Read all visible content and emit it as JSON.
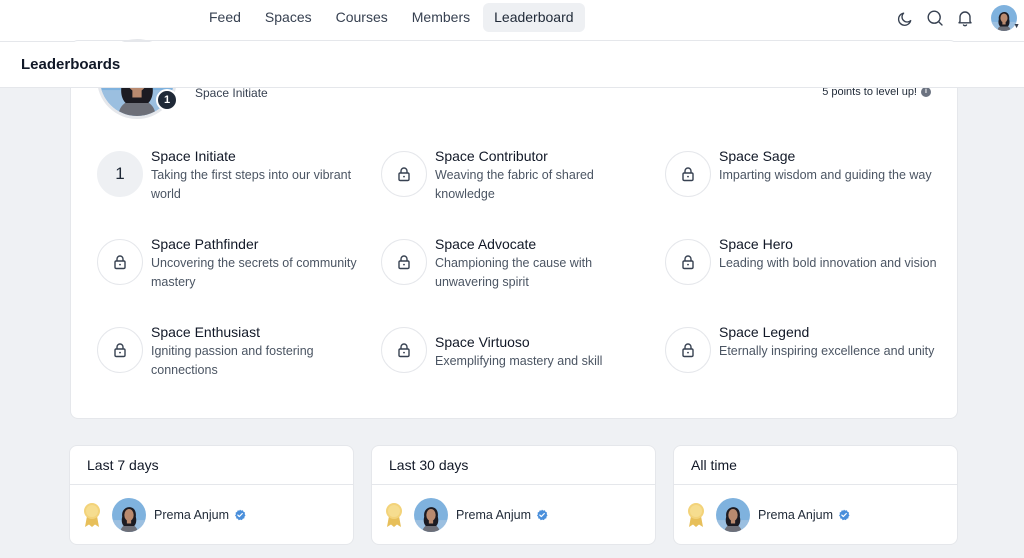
{
  "nav": {
    "tabs": [
      {
        "label": "Feed"
      },
      {
        "label": "Spaces"
      },
      {
        "label": "Courses"
      },
      {
        "label": "Members"
      },
      {
        "label": "Leaderboard"
      }
    ],
    "active_tab": "Leaderboard",
    "icons": [
      "moon-icon",
      "search-icon",
      "bell-icon"
    ]
  },
  "page": {
    "title": "Leaderboards"
  },
  "profile": {
    "level_badge": "1",
    "current_level": "Space Initiate",
    "points_to_level": "5 points to level up!"
  },
  "levels": [
    {
      "number": "1",
      "name": "Space Initiate",
      "description": "Taking the first steps into our vibrant world",
      "unlocked": true
    },
    {
      "name": "Space Contributor",
      "description": "Weaving the fabric of shared knowledge",
      "unlocked": false
    },
    {
      "name": "Space Sage",
      "description": "Imparting wisdom and guiding the way",
      "unlocked": false
    },
    {
      "name": "Space Pathfinder",
      "description": "Uncovering the secrets of community mastery",
      "unlocked": false
    },
    {
      "name": "Space Advocate",
      "description": "Championing the cause with unwavering spirit",
      "unlocked": false
    },
    {
      "name": "Space Hero",
      "description": "Leading with bold innovation and vision",
      "unlocked": false
    },
    {
      "name": "Space Enthusiast",
      "description": "Igniting passion and fostering connections",
      "unlocked": false
    },
    {
      "name": "Space Virtuoso",
      "description": "Exemplifying mastery and skill",
      "unlocked": false
    },
    {
      "name": "Space Legend",
      "description": "Eternally inspiring excellence and unity",
      "unlocked": false
    }
  ],
  "leaderboards": [
    {
      "title": "Last 7 days",
      "entries": [
        {
          "rank": "1",
          "name": "Prema Anjum",
          "verified": true
        }
      ]
    },
    {
      "title": "Last 30 days",
      "entries": [
        {
          "rank": "1",
          "name": "Prema Anjum",
          "verified": true
        }
      ]
    },
    {
      "title": "All time",
      "entries": [
        {
          "rank": "1",
          "name": "Prema Anjum",
          "verified": true
        }
      ]
    }
  ],
  "colors": {
    "background": "#eff1f4",
    "medal": "#f3d37a",
    "verified": "#4a8fdb"
  }
}
